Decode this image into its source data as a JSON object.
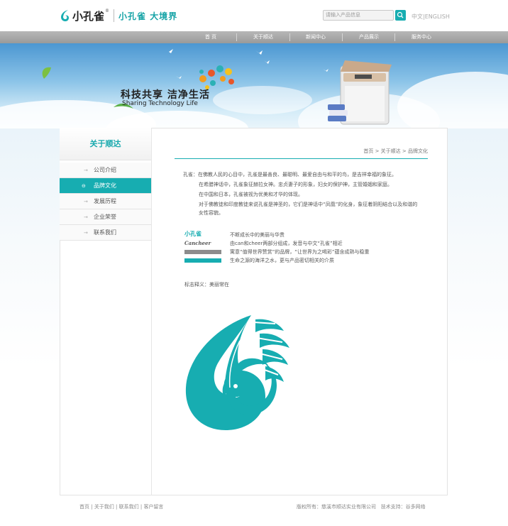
{
  "header": {
    "logo_text": "小孔雀",
    "logo_reg": "®",
    "slogan": "小孔雀  大境界",
    "search_placeholder": "请输入产品信息",
    "lang_cn": "中文",
    "lang_sep": " | ",
    "lang_en": "ENGLISH"
  },
  "nav": {
    "items": [
      "首 页",
      "关于顺达",
      "新闻中心",
      "产品展示",
      "服务中心"
    ]
  },
  "banner": {
    "title_cn": "科技共享  洁净生活",
    "title_en": "Sharing Technology Life"
  },
  "sidebar": {
    "title": "关于顺达",
    "items": [
      {
        "label": "公司介绍",
        "active": false
      },
      {
        "label": "品牌文化",
        "active": true
      },
      {
        "label": "发展历程",
        "active": false
      },
      {
        "label": "企业荣誉",
        "active": false
      },
      {
        "label": "联系我们",
        "active": false
      }
    ]
  },
  "breadcrumb": {
    "home": "首页",
    "sep": " > ",
    "section": "关于顺达",
    "current": "品牌文化"
  },
  "content": {
    "p1": "孔雀：在佛教人民的心目中，孔雀是最善良、最聪明、最爱自由与和平的鸟，是吉祥幸福的象征。",
    "p2": "在希腊神话中，孔雀象征赫拉女神。忠贞妻子的形象，妇女的保护神，主管婚姻和家庭。",
    "p3": "在中国和日本，孔雀被视为优美和才华的体现。",
    "p4": "对于佛教徒和印度教徒来说孔雀是神圣的，它们是神话中“凤凰”的化身，象征着阴阳结合以及和谐的女性容貌。",
    "legend": [
      {
        "mark": "小孔雀",
        "text": "不断成长中的美丽与华贵"
      },
      {
        "mark": "Cancheer",
        "text": "由can和cheer两部分组成，发音与中文“孔雀”相近"
      },
      {
        "mark": "",
        "text": "寓意“值得世界赞赏”的品牌，“让世界为之喝彩”蕴含成熟与稳重"
      },
      {
        "mark": "",
        "text": "生命之源的海洋之水，更与产品密切相关的介质"
      }
    ],
    "meaning": "标志释义：美丽常在"
  },
  "footer": {
    "links": [
      "首页",
      "关于我们",
      "联系我们",
      "客户留言"
    ],
    "link_sep": " | ",
    "copyright": "版权所有：慈溪市顺达实业有限公司",
    "support": "技术支持：谷多网络"
  },
  "colors": {
    "accent": "#17adb1",
    "bar_gray": "#8c8c8c",
    "nav_gray": "#a8a8a8"
  }
}
